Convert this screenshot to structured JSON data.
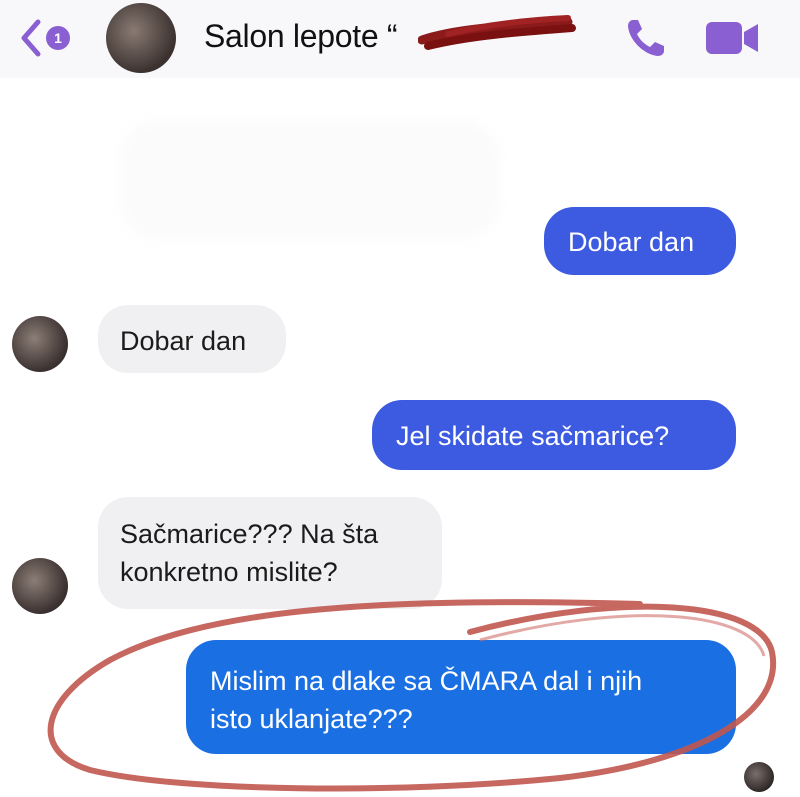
{
  "header": {
    "back_badge": "1",
    "contact_name": "Salon lepote “",
    "colors": {
      "accent": "#8a5fd1",
      "redaction": "#8b1a1a"
    },
    "icons": [
      "chevron-left-icon",
      "phone-icon",
      "video-camera-icon"
    ]
  },
  "messages": [
    {
      "side": "outgoing",
      "text": "Dobar dan"
    },
    {
      "side": "incoming",
      "text": "Dobar dan"
    },
    {
      "side": "outgoing",
      "text": "Jel skidate sačmarice?"
    },
    {
      "side": "incoming",
      "lines": [
        "Sačmarice??? Na šta",
        "konkretno mislite?"
      ]
    },
    {
      "side": "outgoing",
      "lines": [
        "Mislim na dlake sa ČMARA dal i njih",
        "isto uklanjate???"
      ]
    }
  ],
  "colors": {
    "outgoing_bubble": "#3d5be0",
    "outgoing_last_bubble": "#1a6fe3",
    "incoming_bubble": "#f0f0f2",
    "annotation_circle": "#c0574f"
  }
}
